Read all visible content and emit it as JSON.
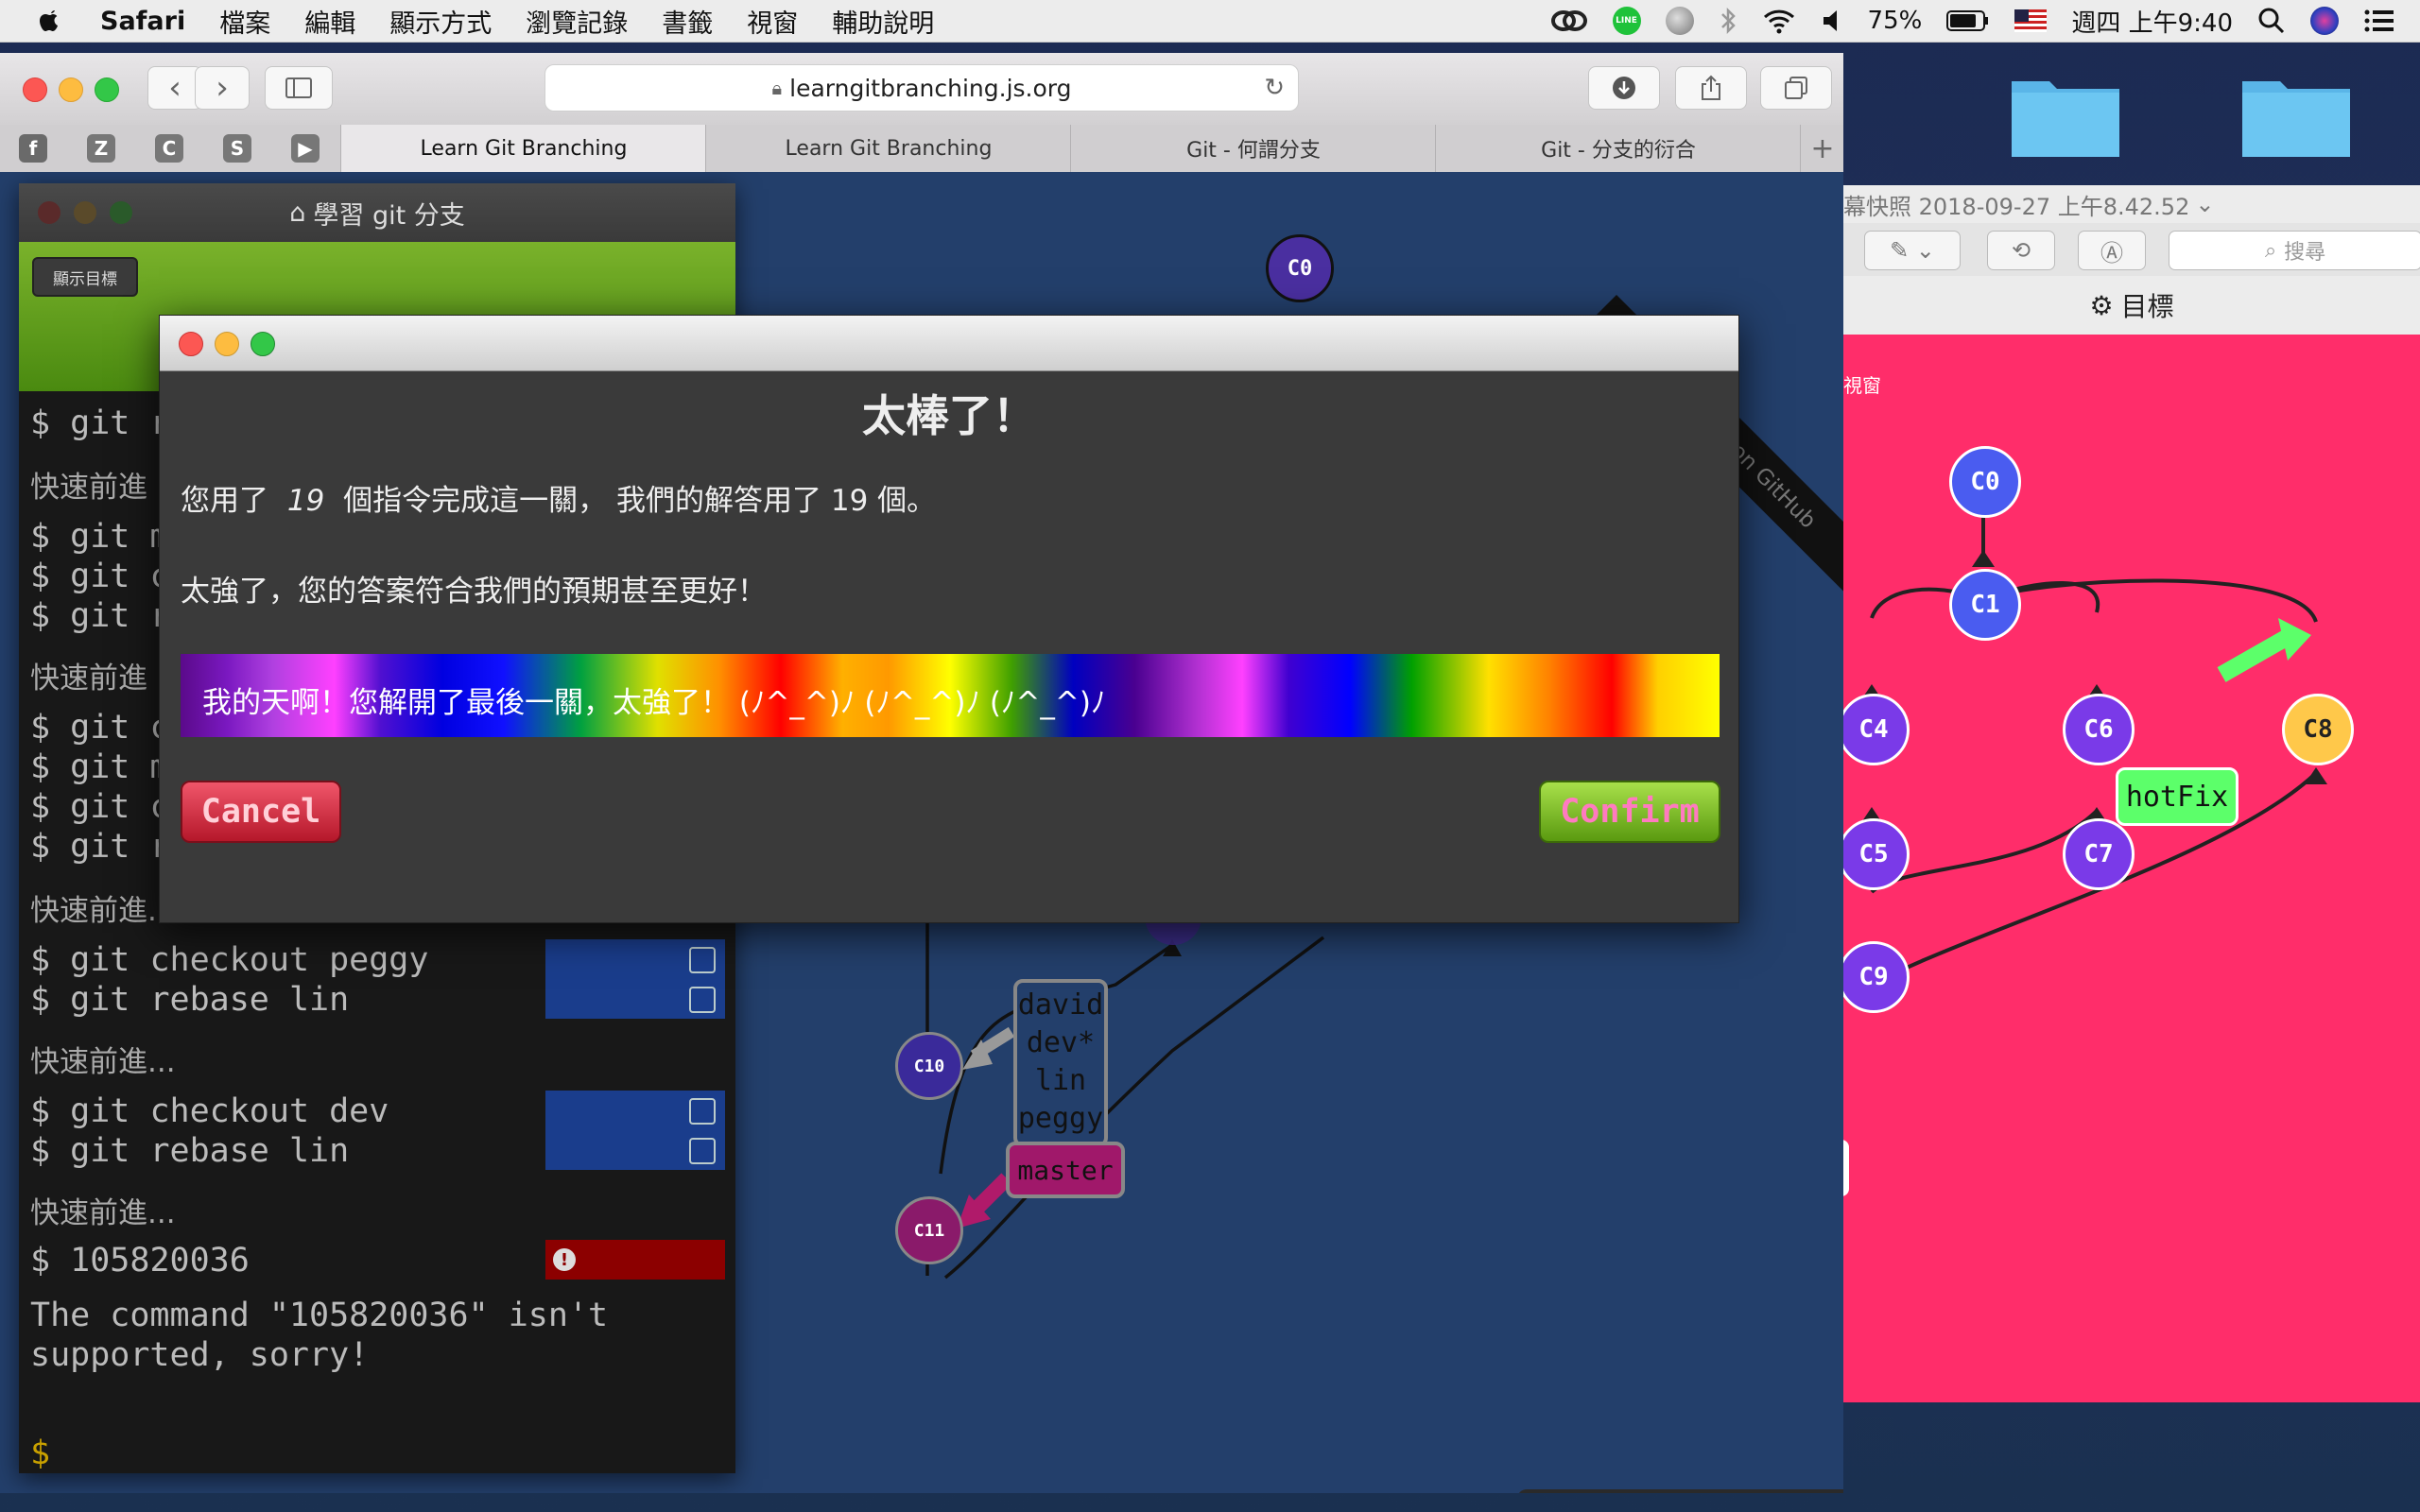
{
  "menubar": {
    "app": "Safari",
    "items": [
      "檔案",
      "編輯",
      "顯示方式",
      "瀏覽記錄",
      "書籤",
      "視窗",
      "輔助說明"
    ],
    "battery": "75%",
    "clock": "週四 上午9:40"
  },
  "safari": {
    "url": "learngitbranching.js.org",
    "favorites": [
      "Z",
      "C",
      "S"
    ],
    "tabs": [
      {
        "label": "Learn Git Branching",
        "active": true
      },
      {
        "label": "Learn Git Branching",
        "active": false
      },
      {
        "label": "Git - 何謂分支",
        "active": false
      },
      {
        "label": "Git - 分支的衍合",
        "active": false
      }
    ]
  },
  "terminal": {
    "title": "學習 git 分支",
    "show_goal": "顯示目標",
    "prompt": "$",
    "partial_lines": [
      "git r",
      "git m",
      "git c",
      "git r",
      "git c",
      "git m",
      "git c",
      "git r"
    ],
    "partial_zh": [
      "快速前進",
      "快速前進"
    ],
    "ff_text": "快速前進...",
    "commands": [
      "git checkout peggy",
      "git rebase lin",
      "git checkout dev",
      "git rebase lin",
      "105820036"
    ],
    "error": "The command \"105820036\" isn't",
    "error2": "supported, sorry!",
    "cursor_prompt": "$"
  },
  "graph": {
    "ribbon": "Fork me on GitHub",
    "nodes": [
      "C0",
      "C10",
      "C11"
    ],
    "labels": [
      "david",
      "dev*",
      "lin",
      "peggy"
    ],
    "master_label": "master"
  },
  "modal": {
    "title": "太棒了！",
    "line1_pre": "您用了",
    "line1_count": "19",
    "line1_post": "個指令完成這一關， 我們的解答用了 19 個。",
    "line2": "太強了，您的答案符合我們的預期甚至更好！",
    "rainbow_text": "我的天啊！您解開了最後一關，太強了！ (ﾉ^_^)ﾉ (ﾉ^_^)ﾉ (ﾉ^_^)ﾉ",
    "cancel": "Cancel",
    "confirm": "Confirm"
  },
  "viewer": {
    "title": "幕快照 2018-09-27 上午8.42.52",
    "search_placeholder": "搜尋",
    "goal": "目標",
    "side_text": "視窗",
    "nodes": [
      "C0",
      "C1",
      "C4",
      "C6",
      "C8",
      "C5",
      "C7",
      "C9"
    ],
    "hotfix": "hotFix"
  }
}
